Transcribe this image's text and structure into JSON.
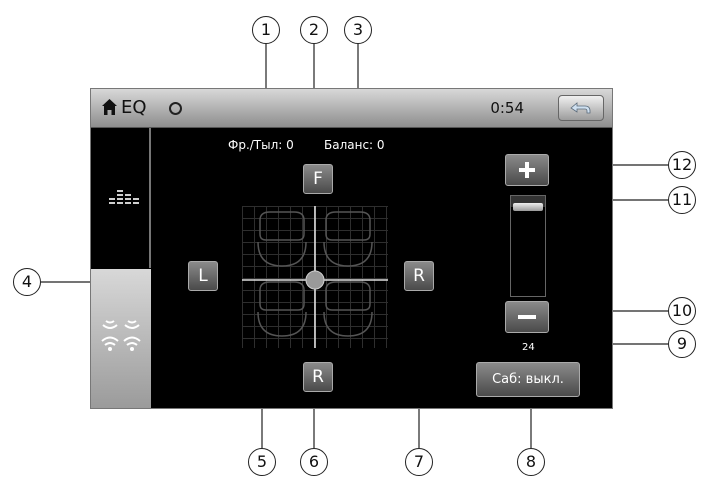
{
  "header": {
    "title": "EQ",
    "time": "0:54"
  },
  "labels": {
    "fader": "Фр./Тыл: 0",
    "balance": "Баланс: 0"
  },
  "controls": {
    "front_label": "F",
    "left_label": "L",
    "right_label": "R",
    "rear_label": "R",
    "subwoofer_label": "Саб: выкл."
  },
  "volume": {
    "value": "24",
    "level_fraction": 0.92
  },
  "callouts": [
    "1",
    "2",
    "3",
    "4",
    "5",
    "6",
    "7",
    "8",
    "9",
    "10",
    "11",
    "12"
  ],
  "icons": {
    "home": "home-icon",
    "status": "circle-icon",
    "back": "back-arrow-icon",
    "equalizer": "equalizer-icon",
    "surround": "surround-speakers-icon"
  }
}
